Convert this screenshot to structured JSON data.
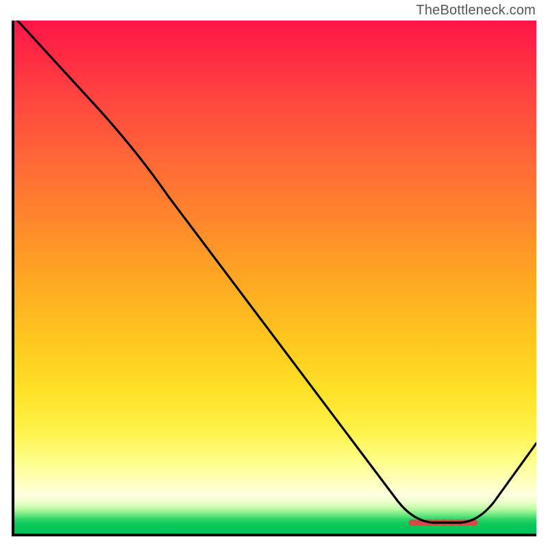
{
  "attribution": "TheBottleneck.com",
  "chart_data": {
    "type": "line",
    "title": "",
    "xlabel": "",
    "ylabel": "",
    "xlim": [
      0,
      100
    ],
    "ylim": [
      0,
      100
    ],
    "series": [
      {
        "name": "bottleneck-curve",
        "x": [
          0,
          14,
          22,
          30,
          40,
          50,
          60,
          70,
          74,
          78,
          82,
          86,
          90,
          95,
          100
        ],
        "y": [
          100,
          85,
          76,
          66,
          53,
          40,
          27,
          13,
          6,
          2,
          2,
          2,
          5,
          12,
          18
        ]
      }
    ],
    "optimal_range_x": [
      76,
      88
    ],
    "background": {
      "type": "vertical-gradient",
      "stops": [
        {
          "pos": 0.0,
          "color": "#ff1546"
        },
        {
          "pos": 0.5,
          "color": "#ffb020"
        },
        {
          "pos": 0.8,
          "color": "#fff24a"
        },
        {
          "pos": 0.93,
          "color": "#ffffe0"
        },
        {
          "pos": 1.0,
          "color": "#00c255"
        }
      ]
    }
  }
}
